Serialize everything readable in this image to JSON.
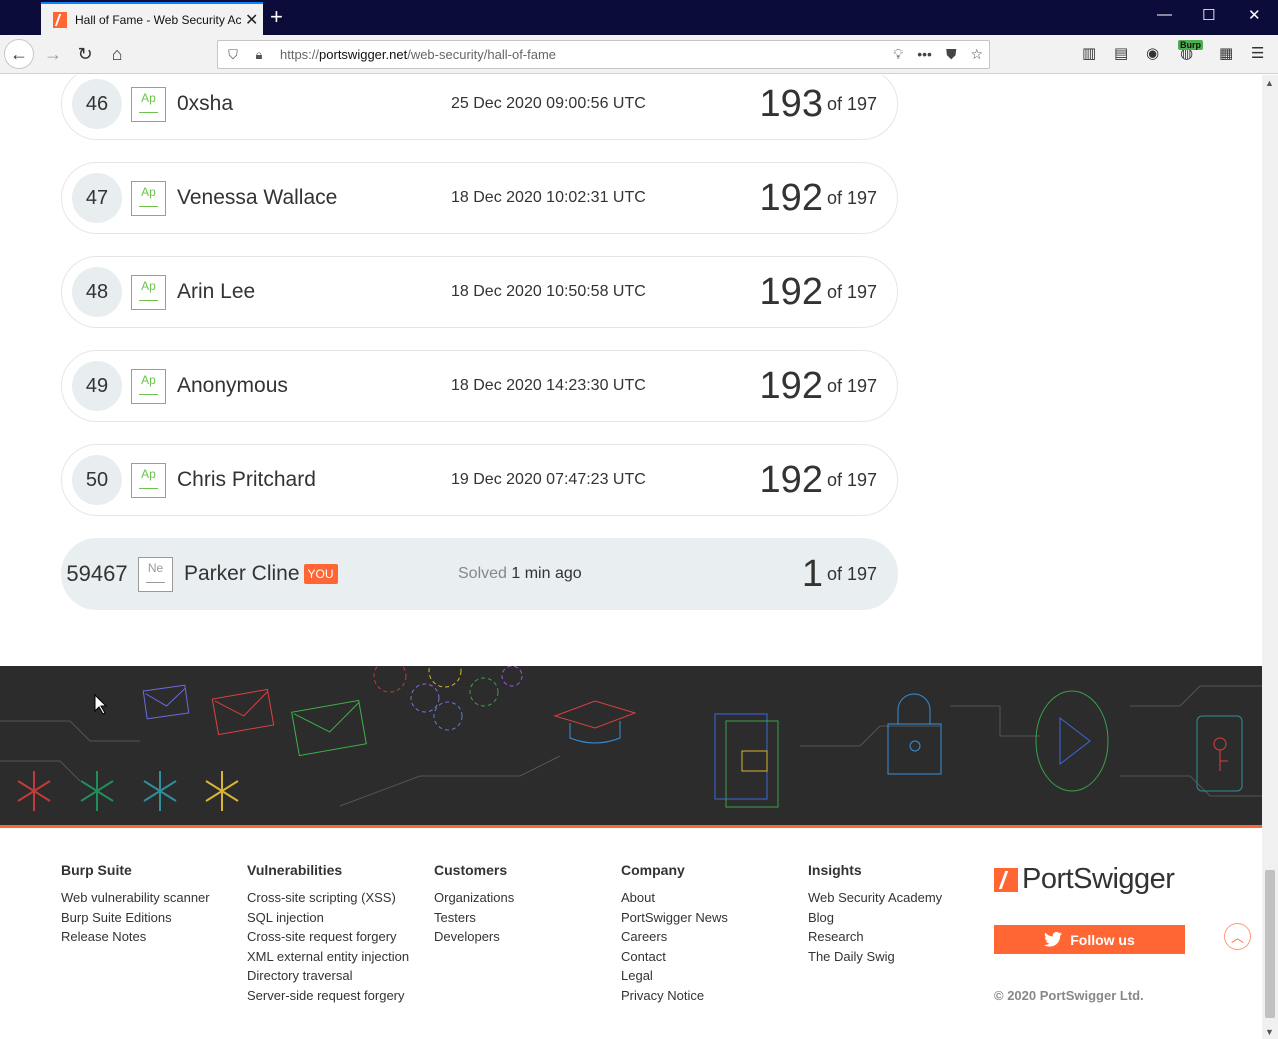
{
  "browser": {
    "tab_title": "Hall of Fame - Web Security Ac",
    "url_prefix": "https://",
    "url_host": "portswigger.net",
    "url_path": "/web-security/hall-of-fame",
    "burp_label": "Burp"
  },
  "leaderboard": {
    "rows": [
      {
        "rank": "46",
        "level": "Ap",
        "name": "0xsha",
        "date": "25 Dec 2020 09:00:56 UTC",
        "score": "193",
        "of": "of 197"
      },
      {
        "rank": "47",
        "level": "Ap",
        "name": "Venessa Wallace",
        "date": "18 Dec 2020 10:02:31 UTC",
        "score": "192",
        "of": "of 197"
      },
      {
        "rank": "48",
        "level": "Ap",
        "name": "Arin Lee",
        "date": "18 Dec 2020 10:50:58 UTC",
        "score": "192",
        "of": "of 197"
      },
      {
        "rank": "49",
        "level": "Ap",
        "name": "Anonymous",
        "date": "18 Dec 2020 14:23:30 UTC",
        "score": "192",
        "of": "of 197"
      },
      {
        "rank": "50",
        "level": "Ap",
        "name": "Chris Pritchard",
        "date": "19 Dec 2020 07:47:23 UTC",
        "score": "192",
        "of": "of 197"
      }
    ],
    "you": {
      "rank": "59467",
      "level": "Ne",
      "name": "Parker Cline",
      "badge": "YOU",
      "solved_label": "Solved",
      "solved_time": "1 min ago",
      "score": "1",
      "of": "of 197"
    }
  },
  "footer": {
    "columns": [
      {
        "title": "Burp Suite",
        "links": [
          "Web vulnerability scanner",
          "Burp Suite Editions",
          "Release Notes"
        ]
      },
      {
        "title": "Vulnerabilities",
        "links": [
          "Cross-site scripting (XSS)",
          "SQL injection",
          "Cross-site request forgery",
          "XML external entity injection",
          "Directory traversal",
          "Server-side request forgery"
        ]
      },
      {
        "title": "Customers",
        "links": [
          "Organizations",
          "Testers",
          "Developers"
        ]
      },
      {
        "title": "Company",
        "links": [
          "About",
          "PortSwigger News",
          "Careers",
          "Contact",
          "Legal",
          "Privacy Notice"
        ]
      },
      {
        "title": "Insights",
        "links": [
          "Web Security Academy",
          "Blog",
          "Research",
          "The Daily Swig"
        ]
      }
    ],
    "brand": "PortSwigger",
    "follow_label": "Follow us",
    "copyright": "© 2020 PortSwigger Ltd."
  },
  "colors": {
    "accent": "#ff6633",
    "level_green": "#6cc24a",
    "banner_bg": "#2c2c2c"
  },
  "icons": [
    "back-arrow-icon",
    "forward-arrow-icon",
    "reload-icon",
    "home-icon",
    "shield-icon",
    "lock-icon",
    "lightbulb-icon",
    "more-icon",
    "pocket-icon",
    "star-icon",
    "library-icon",
    "sidebar-icon",
    "account-icon",
    "extensions-icon",
    "menu-icon",
    "twitter-icon",
    "arrow-up-icon"
  ]
}
